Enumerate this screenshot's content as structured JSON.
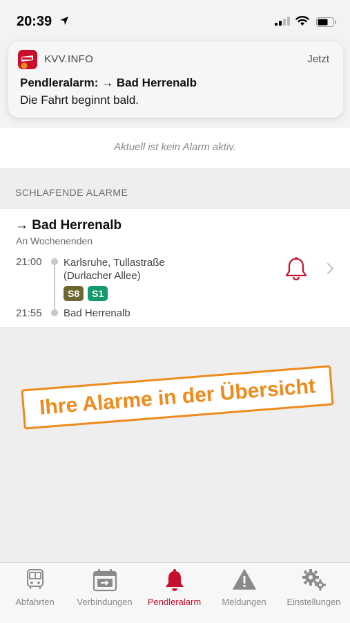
{
  "status_bar": {
    "time": "20:39"
  },
  "notification": {
    "app_name": "KVV.INFO",
    "time": "Jetzt",
    "title": "Pendleralarm: → Bad Herrenalb",
    "body": "Die Fahrt beginnt bald."
  },
  "main": {
    "no_alarm_text": "Aktuell ist kein Alarm aktiv.",
    "section_header": "SCHLAFENDE ALARME",
    "alarm": {
      "title": "→ Bad Herrenalb",
      "schedule": "An Wochenenden",
      "departure_time": "21:00",
      "departure_stop_line1": "Karlsruhe, Tullastraße",
      "departure_stop_line2": "(Durlacher Allee)",
      "lines": [
        {
          "label": "S8",
          "color": "#6f6530"
        },
        {
          "label": "S1",
          "color": "#139a6a"
        }
      ],
      "arrival_time": "21:55",
      "arrival_stop": "Bad Herrenalb"
    }
  },
  "stamp": {
    "text": "Ihre Alarme in der Übersicht"
  },
  "tab_bar": {
    "tabs": [
      {
        "label": "Abfahrten",
        "icon": "bus-icon"
      },
      {
        "label": "Verbindungen",
        "icon": "calendar-route-icon"
      },
      {
        "label": "Pendleralarm",
        "icon": "bell-icon",
        "active": true
      },
      {
        "label": "Meldungen",
        "icon": "warning-icon"
      },
      {
        "label": "Einstellungen",
        "icon": "gears-icon"
      }
    ]
  },
  "colors": {
    "accent": "#c8102e",
    "stamp": "#ef8a1c"
  }
}
